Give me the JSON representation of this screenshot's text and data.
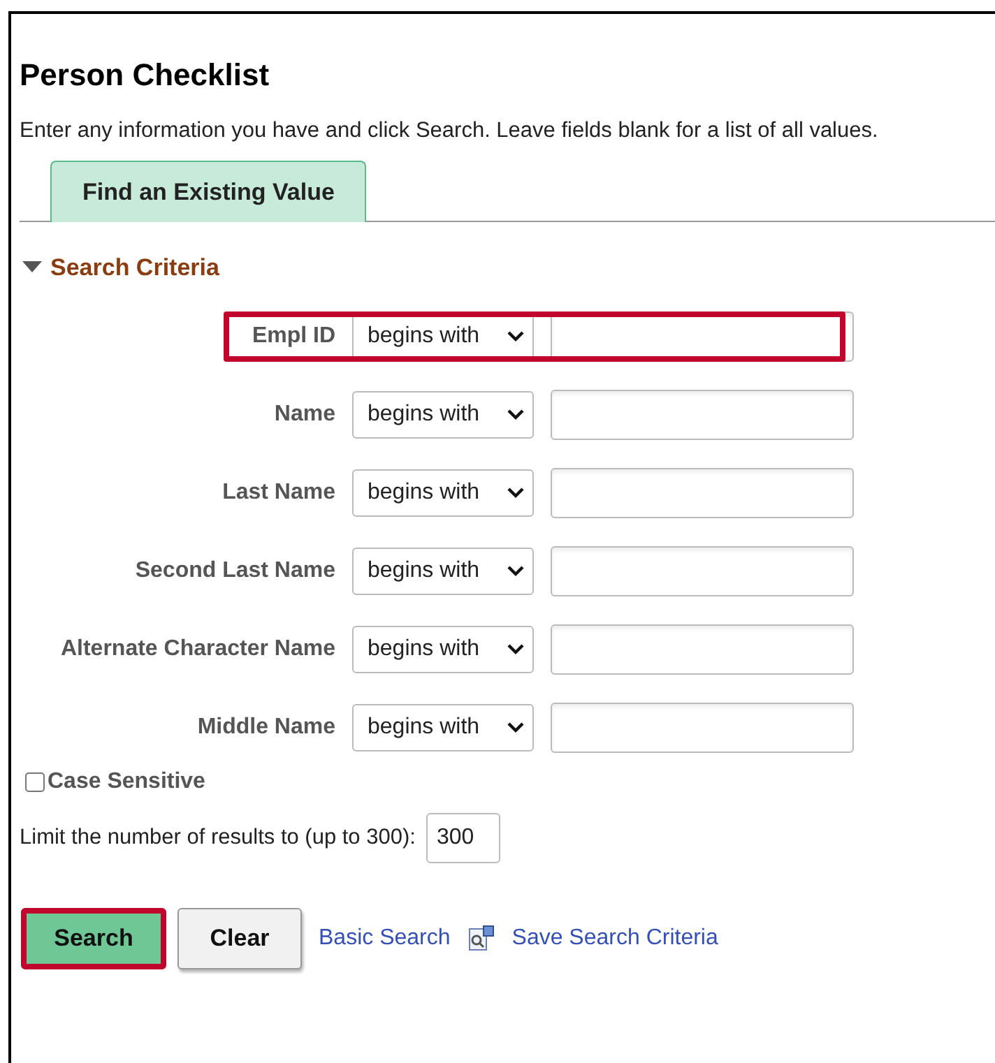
{
  "page": {
    "title": "Person Checklist",
    "instructions": "Enter any information you have and click Search. Leave fields blank for a list of all values."
  },
  "tabs": [
    {
      "label": "Find an Existing Value",
      "selected": true
    }
  ],
  "section": {
    "title": "Search Criteria",
    "expanded": true
  },
  "criteria": [
    {
      "label": "Empl ID",
      "operator": "begins with",
      "highlighted": true
    },
    {
      "label": "Name",
      "operator": "begins with",
      "highlighted": false
    },
    {
      "label": "Last Name",
      "operator": "begins with",
      "highlighted": false
    },
    {
      "label": "Second Last Name",
      "operator": "begins with",
      "highlighted": false
    },
    {
      "label": "Alternate Character Name",
      "operator": "begins with",
      "highlighted": false
    },
    {
      "label": "Middle Name",
      "operator": "begins with",
      "highlighted": false
    }
  ],
  "case_sensitive": {
    "label": "Case Sensitive",
    "checked": false
  },
  "limit": {
    "label": "Limit the number of results to (up to 300):",
    "value": "300"
  },
  "buttons": [
    {
      "label": "Search",
      "kind": "primary",
      "highlighted": true
    },
    {
      "label": "Clear",
      "kind": "secondary",
      "highlighted": false
    }
  ],
  "links": [
    {
      "label": "Basic Search",
      "icon": false
    },
    {
      "label": "Save Search Criteria",
      "icon": true
    }
  ]
}
